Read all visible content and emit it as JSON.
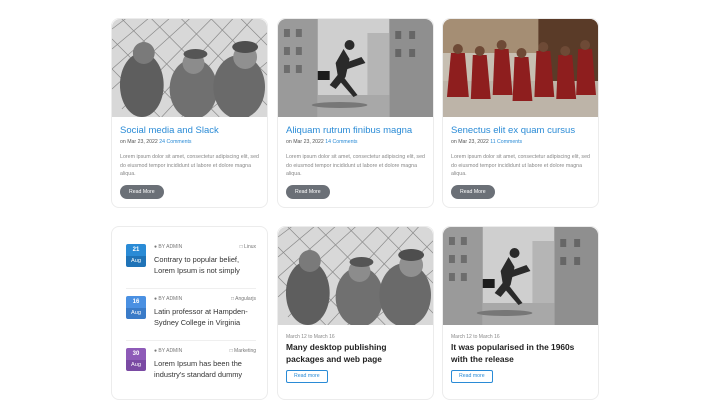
{
  "top_cards": [
    {
      "title": "Social media and Slack",
      "date": "on Mar 23, 2022",
      "comments": "24 Comments",
      "excerpt": "Lorem ipsum dolor sit amet, consectetur adipiscing elit, sed do eiusmod tempor incididunt ut labore et dolore magna aliqua.",
      "button": "Read More",
      "image": "children-at-fence-photo"
    },
    {
      "title": "Aliquam rutrum finibus magna",
      "date": "on Mar 23, 2022",
      "comments": "14 Comments",
      "excerpt": "Lorem ipsum dolor sit amet, consectetur adipiscing elit, sed do eiusmod tempor incididunt ut labore et dolore magna aliqua.",
      "button": "Read More",
      "image": "jumping-man-street-photo"
    },
    {
      "title": "Senectus elit ex quam cursus",
      "date": "on Mar 23, 2022",
      "comments": "11 Comments",
      "excerpt": "Lorem ipsum dolor sit amet, consectetur adipiscing elit, sed do eiusmod tempor incididunt ut labore et dolore magna aliqua.",
      "button": "Read More",
      "image": "monks-in-red-robes-photo"
    }
  ],
  "news_list": [
    {
      "day": "21",
      "month": "Aug",
      "badge_color": "#2a8bd6",
      "by": "BY ADMIN",
      "category": "Linux",
      "text": "Contrary to popular belief, Lorem Ipsum is not simply"
    },
    {
      "day": "16",
      "month": "Aug",
      "badge_color": "#4a90e2",
      "by": "BY ADMIN",
      "category": "Angularjs",
      "text": "Latin professor at Hampden-Sydney College in Virginia"
    },
    {
      "day": "30",
      "month": "Aug",
      "badge_color": "#8e5bb8",
      "by": "BY ADMIN",
      "category": "Marketing",
      "text": "Lorem Ipsum has been the industry's standard dummy"
    }
  ],
  "bottom_cards": [
    {
      "date": "March 12 to March 16",
      "title": "Many desktop publishing packages and web page",
      "button": "Read more",
      "image": "children-at-fence-photo"
    },
    {
      "date": "March 12 to March 16",
      "title": "It was popularised in the 1960s with the release",
      "button": "Read more",
      "image": "jumping-man-street-photo"
    }
  ]
}
